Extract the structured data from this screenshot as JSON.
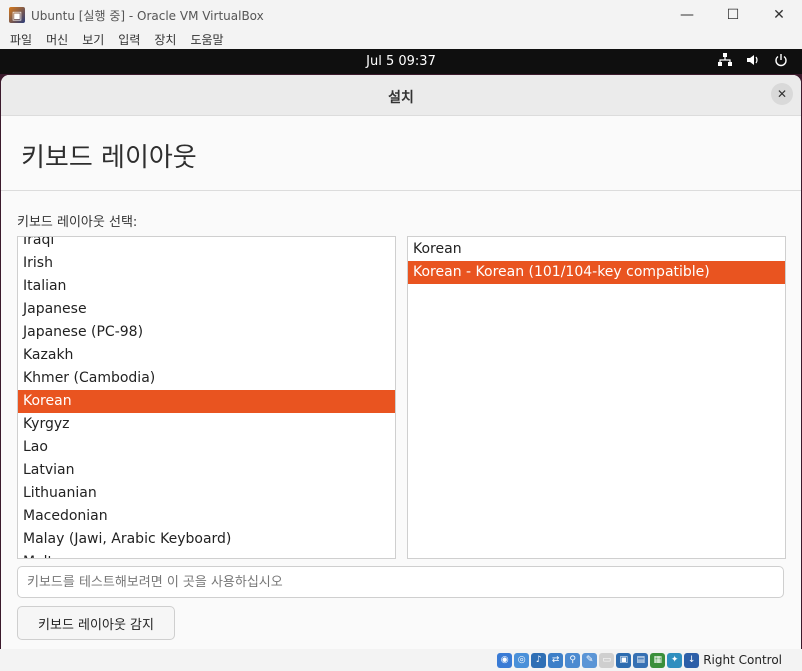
{
  "window": {
    "title": "Ubuntu [실행 중] - Oracle VM VirtualBox",
    "minimize_glyph": "—",
    "maximize_glyph": "☐",
    "close_glyph": "✕"
  },
  "menubar": [
    "파일",
    "머신",
    "보기",
    "입력",
    "장치",
    "도움말"
  ],
  "topbar": {
    "clock": "Jul 5  09:37"
  },
  "dialog": {
    "header_title": "설치",
    "page_title": "키보드 레이아웃",
    "section_label": "키보드 레이아웃 선택:",
    "layouts": [
      "Iraqi",
      "Irish",
      "Italian",
      "Japanese",
      "Japanese (PC-98)",
      "Kazakh",
      "Khmer (Cambodia)",
      "Korean",
      "Kyrgyz",
      "Lao",
      "Latvian",
      "Lithuanian",
      "Macedonian",
      "Malay (Jawi, Arabic Keyboard)",
      "Maltese"
    ],
    "selected_layout": "Korean",
    "variants": [
      "Korean",
      "Korean - Korean (101/104-key compatible)"
    ],
    "selected_variant": "Korean - Korean (101/104-key compatible)",
    "test_placeholder": "키보드를 테스트해보려면 이 곳을 사용하십시오",
    "test_value": "",
    "detect_button": "키보드 레이아웃 감지"
  },
  "statusbar": {
    "host_key": "Right Control"
  },
  "colors": {
    "accent": "#e95420",
    "dialog_bg": "#fafafa",
    "topbar": "#0f0f0f"
  }
}
